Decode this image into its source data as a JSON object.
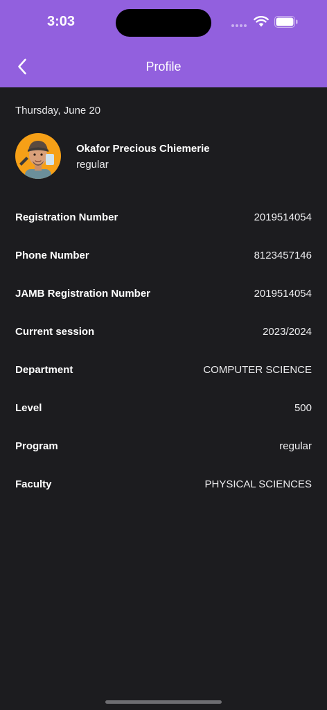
{
  "status_bar": {
    "time": "3:03"
  },
  "header": {
    "title": "Profile"
  },
  "date": "Thursday, June 20",
  "profile": {
    "name": "Okafor Precious Chiemerie",
    "type": "regular"
  },
  "details": [
    {
      "label": "Registration Number",
      "value": "2019514054"
    },
    {
      "label": "Phone Number",
      "value": "8123457146"
    },
    {
      "label": "JAMB Registration Number",
      "value": "2019514054"
    },
    {
      "label": "Current session",
      "value": "2023/2024"
    },
    {
      "label": "Department",
      "value": "COMPUTER SCIENCE"
    },
    {
      "label": "Level",
      "value": "500"
    },
    {
      "label": "Program",
      "value": "regular"
    },
    {
      "label": "Faculty",
      "value": "PHYSICAL SCIENCES"
    }
  ],
  "colors": {
    "accent": "#9260de",
    "background": "#1c1c1f",
    "avatar_bg": "#f6a017"
  },
  "icons": [
    "wifi-icon",
    "battery-icon",
    "back-chevron-icon",
    "avatar-memoji"
  ]
}
